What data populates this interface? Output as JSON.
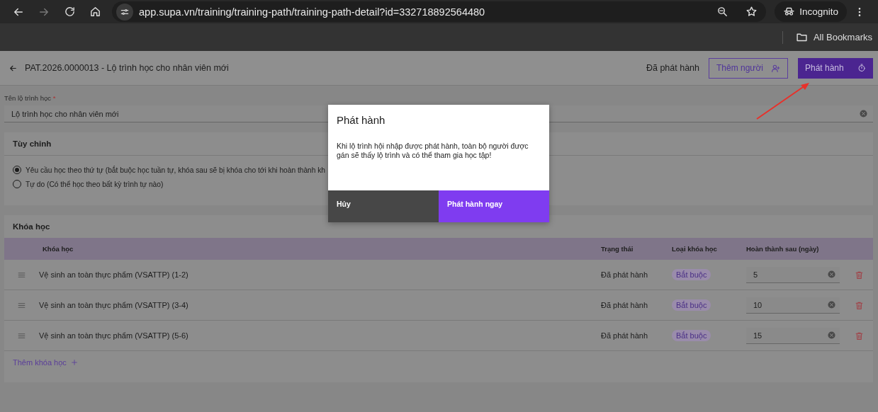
{
  "browser": {
    "url": "app.supa.vn/training/training-path/training-path-detail?id=332718892564480",
    "profile_label": "Incognito",
    "bookmarks_label": "All Bookmarks"
  },
  "header": {
    "title": "PAT.2026.0000013 - Lộ trình học cho nhân viên mới",
    "status": "Đã phát hành",
    "add_people_button": "Thêm người",
    "publish_button": "Phát hành"
  },
  "name_field": {
    "label": "Tên lộ trình học",
    "required_mark": "*",
    "value": "Lộ trình học cho nhân viên mới"
  },
  "customize": {
    "title": "Tùy chỉnh",
    "options": [
      {
        "label": "Yêu cầu học theo thứ tự (bắt buộc học tuần tự, khóa sau sẽ bị khóa cho tới khi hoàn thành kh",
        "selected": true
      },
      {
        "label": "Tự do (Có thể học theo bất kỳ trình tự nào)",
        "selected": false
      }
    ]
  },
  "courses": {
    "title": "Khóa học",
    "columns": [
      "Khóa học",
      "Trạng thái",
      "Loại khóa học",
      "Hoàn thành sau (ngày)"
    ],
    "rows": [
      {
        "name": "Vệ sinh an toàn thực phẩm (VSATTP) (1-2)",
        "status": "Đã phát hành",
        "type": "Bắt buộc",
        "days": "5"
      },
      {
        "name": "Vệ sinh an toàn thực phẩm (VSATTP) (3-4)",
        "status": "Đã phát hành",
        "type": "Bắt buộc",
        "days": "10"
      },
      {
        "name": "Vệ sinh an toàn thực phẩm (VSATTP) (5-6)",
        "status": "Đã phát hành",
        "type": "Bắt buộc",
        "days": "15"
      }
    ],
    "add_link": "Thêm khóa học"
  },
  "dialog": {
    "title": "Phát hành",
    "message": "Khi lộ trình hội nhập được phát hành, toàn bộ người được gán sẽ thấy lộ trình và có thể tham gia học tập!",
    "cancel_button": "Hủy",
    "confirm_button": "Phát hành ngay"
  }
}
